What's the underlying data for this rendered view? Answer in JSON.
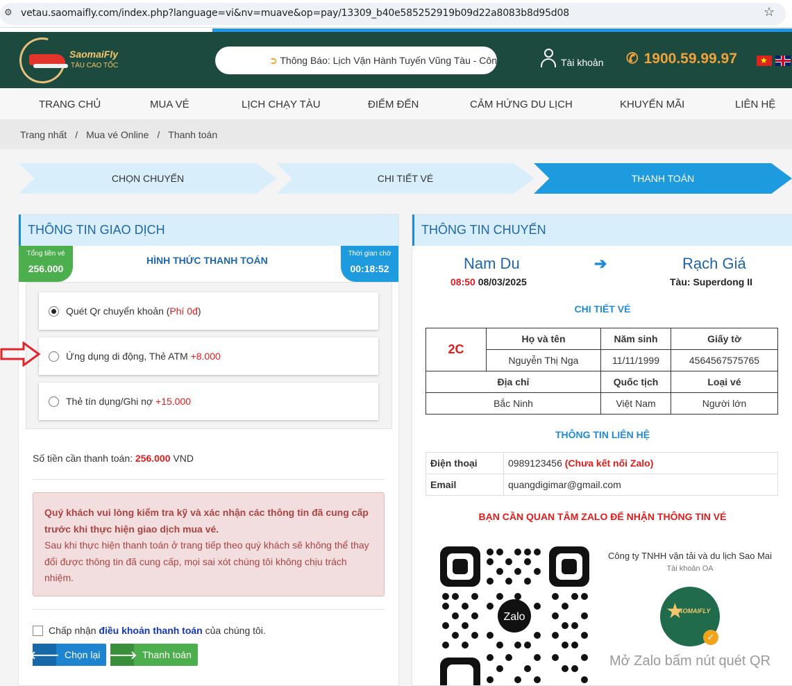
{
  "browser": {
    "url": "vetau.saomaifly.com/index.php?language=vi&nv=muave&op=pay/13309_b40e585252919b09d22a8083b8d95d08"
  },
  "header": {
    "logo_name": "SaomaiFly",
    "logo_sub": "TÀU CAO TỐC",
    "notice": "Thông Báo: Lịch Vận Hành Tuyến Vũng Tàu - Côn Đảo",
    "account": "Tài khoản",
    "hotline": "1900.59.99.97"
  },
  "nav": [
    "TRANG CHỦ",
    "MUA VÉ",
    "LỊCH CHẠY TÀU",
    "ĐIỂM ĐẾN",
    "CẢM HỨNG DU LỊCH",
    "KHUYẾN MÃI",
    "LIÊN HỆ"
  ],
  "breadcrumb": [
    "Trang nhất",
    "/",
    "Mua vé Online",
    "/",
    "Thanh toán"
  ],
  "steps": [
    "CHỌN CHUYẾN",
    "CHI TIẾT VÉ",
    "THANH TOÁN"
  ],
  "left": {
    "title": "THÔNG TIN GIAO DỊCH",
    "total_label": "Tổng tiền vé",
    "total_value": "256.000",
    "method_title": "HÌNH THỨC THANH TOÁN",
    "time_label": "Thời gian chờ",
    "time_value": "00:18:52",
    "options": [
      {
        "label": "Quét Qr chuyển khoản (",
        "fee": "Phí 0đ",
        "close": ")",
        "selected": true
      },
      {
        "label": "Ứng dụng di động, Thẻ ATM ",
        "fee": "+8.000",
        "close": "",
        "selected": false
      },
      {
        "label": "Thẻ tín dụng/Ghi nợ ",
        "fee": "+15.000",
        "close": "",
        "selected": false
      }
    ],
    "amount_label": "Số tiền cần thanh toán: ",
    "amount_value": "256.000",
    "amount_unit": " VND",
    "warn_bold": "Quý khách vui lòng kiểm tra kỹ và xác nhận các thông tin đã cung cấp trước khi thực hiện giao dịch mua vé.",
    "warn_text": "Sau khi thực hiện thanh toán ở trang tiếp theo quý khách sẽ không thể thay đổi được thông tin đã cung cấp, mọi sai xót chúng tôi không chịu trách nhiệm.",
    "accept_pre": "Chấp nhận ",
    "accept_link": "điều khoản thanh toán",
    "accept_post": " của chúng tôi.",
    "btn_back": "Chọn lại",
    "btn_pay": "Thanh toán"
  },
  "right": {
    "title": "THÔNG TIN CHUYẾN",
    "from": "Nam Du",
    "to": "Rạch Giá",
    "dep_time": "08:50",
    "dep_date": "08/03/2025",
    "ship": "Tàu: Superdong II",
    "ticket_title": "CHI TIẾT VÉ",
    "seat": "2C",
    "h_name": "Họ và tên",
    "h_birth": "Năm sinh",
    "h_doc": "Giấy tờ",
    "name": "Nguyễn Thị Nga",
    "birth": "11/11/1999",
    "doc": "4564567575765",
    "h_addr": "Địa chỉ",
    "h_nat": "Quốc tịch",
    "h_type": "Loại vé",
    "addr": "Bắc Ninh",
    "nat": "Việt Nam",
    "type": "Người lớn",
    "contact_title": "THÔNG TIN LIÊN HỆ",
    "phone_label": "Điện thoại",
    "phone": "0989123456",
    "phone_note": "(Chưa kết nối Zalo)",
    "email_label": "Email",
    "email": "quangdigimar@gmail.com",
    "zalo_note": "BẠN CẦN QUAN TÂM ZALO ĐỂ NHẬN THÔNG TIN VÉ",
    "oa_name": "Công ty TNHH vận tải  và du lịch Sao Mai",
    "oa_sub": "Tài khoản OA",
    "oa_logo": "SAOMAIFLY",
    "qr_center": "Zalo",
    "oa_hint": "Mở Zalo bấm nút quét QR"
  },
  "colors": {
    "header": "#1c4a3f",
    "accent": "#1e9ade",
    "price": "#e21b1b",
    "success": "#4cae4c"
  }
}
